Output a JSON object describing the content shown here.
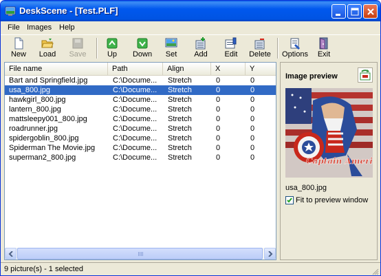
{
  "window": {
    "title": "DeskScene - [Test.PLF]"
  },
  "menu": [
    "File",
    "Images",
    "Help"
  ],
  "toolbar": {
    "new": "New",
    "load": "Load",
    "save": "Save",
    "up": "Up",
    "down": "Down",
    "set": "Set",
    "add": "Add",
    "edit": "Edit",
    "delete": "Delete",
    "options": "Options",
    "exit": "Exit"
  },
  "list": {
    "columns": [
      "File name",
      "Path",
      "Align",
      "X",
      "Y"
    ],
    "rows": [
      {
        "name": "Bart and Springfield.jpg",
        "path": "C:\\Docume...",
        "align": "Stretch",
        "x": "0",
        "y": "0"
      },
      {
        "name": "usa_800.jpg",
        "path": "C:\\Docume...",
        "align": "Stretch",
        "x": "0",
        "y": "0",
        "selected": true
      },
      {
        "name": "hawkgirl_800.jpg",
        "path": "C:\\Docume...",
        "align": "Stretch",
        "x": "0",
        "y": "0"
      },
      {
        "name": "lantern_800.jpg",
        "path": "C:\\Docume...",
        "align": "Stretch",
        "x": "0",
        "y": "0"
      },
      {
        "name": "mattsleepy001_800.jpg",
        "path": "C:\\Docume...",
        "align": "Stretch",
        "x": "0",
        "y": "0"
      },
      {
        "name": "roadrunner.jpg",
        "path": "C:\\Docume...",
        "align": "Stretch",
        "x": "0",
        "y": "0"
      },
      {
        "name": "spidergoblin_800.jpg",
        "path": "C:\\Docume...",
        "align": "Stretch",
        "x": "0",
        "y": "0"
      },
      {
        "name": "Spiderman The Movie.jpg",
        "path": "C:\\Docume...",
        "align": "Stretch",
        "x": "0",
        "y": "0"
      },
      {
        "name": "superman2_800.jpg",
        "path": "C:\\Docume...",
        "align": "Stretch",
        "x": "0",
        "y": "0"
      }
    ]
  },
  "preview": {
    "title": "Image preview",
    "filename": "usa_800.jpg",
    "image_caption": "Captain America",
    "fit_label": "Fit to preview window",
    "fit_checked": true
  },
  "status": {
    "text": "9 picture(s) - 1 selected"
  },
  "colors": {
    "selection": "#316AC5",
    "titlebar": "#0054E3"
  }
}
